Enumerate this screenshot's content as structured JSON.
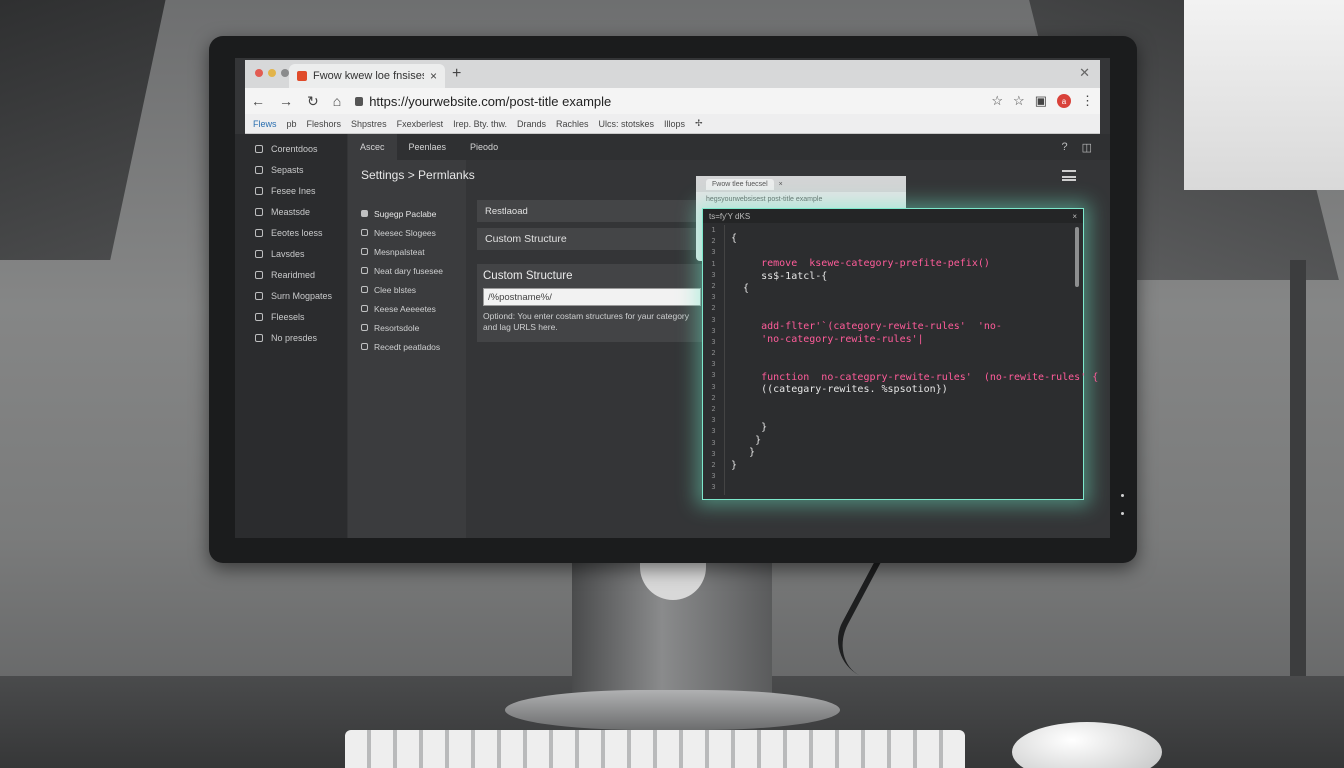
{
  "browser": {
    "tab_title": "Fwow kwew loe fnsises",
    "new_tab_glyph": "+",
    "close_tab_glyph": "×",
    "window_close_glyph": "✕",
    "url": "https://yourwebsite.com/post-title example",
    "profile_initial": "a",
    "traffic_colors": [
      "#e25c52",
      "#e2b44a",
      "#8a8b8c"
    ],
    "bookmarks": [
      "Flews",
      "pb",
      "Fleshors",
      "Shpstres",
      "Fxexberlest",
      "Irep. Bty. thw.",
      "Drands",
      "Rachles",
      "Ulcs: stotskes",
      "Illops",
      "✢"
    ]
  },
  "admin": {
    "sidebar_items": [
      "Corentdoos",
      "Sepasts",
      "Fesee Ines",
      "Meastsde",
      "Eeotes loess",
      "Lavsdes",
      "Rearidmed",
      "Surn Mogpates",
      "Fleesels",
      "No presdes"
    ],
    "topnav": [
      "Ascec",
      "Peenlaes",
      "Pieodo"
    ],
    "page_title": "Settings > Permlanks",
    "subnav": [
      "Sugegp Paclabe",
      "Neesec Slogees",
      "Mesnpalsteat",
      "Neat dary fusesee",
      "Clee blstes",
      "Keese Aeeeetes",
      "Resortsdole",
      "Recedt peatlados"
    ],
    "strip_1": "Restlaoad",
    "strip_2": "Custom Structure",
    "form": {
      "title": "Custom Structure",
      "value": "/%postname%/",
      "help_line_1": "Optiond: You enter costam structures for yaur category",
      "help_line_2": "and lag URLS here."
    }
  },
  "code_window": {
    "mini_tab_label": "Fwow tlee fuecsel",
    "mini_url": "hegsyourwebsisest post-title example",
    "header_title": "ts=fy'Y dKS",
    "close_glyph": "×",
    "line_numbers": [
      "1",
      "2",
      "3",
      "1",
      "3",
      "2",
      "3",
      "2",
      "3",
      "3",
      "3",
      "2",
      "3",
      "3",
      "3",
      "2",
      "2",
      "3",
      "3",
      "3",
      "3",
      "2",
      "3",
      "3"
    ],
    "lines": [
      {
        "text": "{",
        "color": "plain"
      },
      {
        "text": "",
        "color": "plain"
      },
      {
        "text": "     remove  ksewe-category-prefite-pefix()",
        "color": "pink"
      },
      {
        "text": "     ss$-1atcl-{",
        "color": "plain"
      },
      {
        "text": "  {",
        "color": "plain"
      },
      {
        "text": "",
        "color": "plain"
      },
      {
        "text": "",
        "color": "plain"
      },
      {
        "text": "     add-flter'`(category-rewite-rules'  'no-",
        "color": "pink"
      },
      {
        "text": "     'no-category-rewite-rules'|",
        "color": "pink"
      },
      {
        "text": "",
        "color": "plain"
      },
      {
        "text": "",
        "color": "plain"
      },
      {
        "text": "     function  no-categpry-rewite-rules'  (no-rewite-rules' {",
        "color": "pink"
      },
      {
        "text": "     ((categary-rewites. %spsotion})",
        "color": "plain"
      },
      {
        "text": "",
        "color": "plain"
      },
      {
        "text": "",
        "color": "plain"
      },
      {
        "text": "     }",
        "color": "plain"
      },
      {
        "text": "    }",
        "color": "plain"
      },
      {
        "text": "   }",
        "color": "plain"
      },
      {
        "text": "}",
        "color": "plain"
      }
    ],
    "glow_color": "#7de8cc",
    "keyword_color": "#ff5c9a"
  }
}
